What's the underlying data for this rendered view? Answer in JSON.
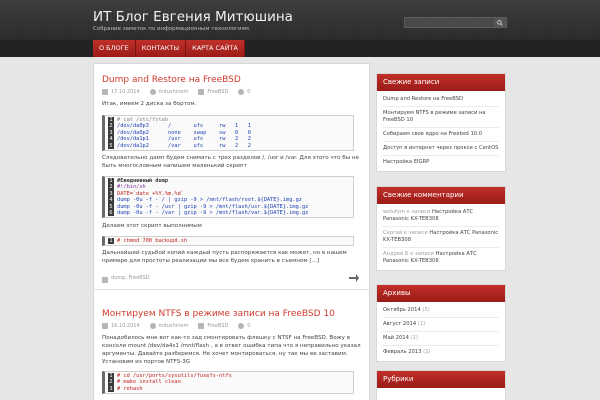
{
  "header": {
    "site_title": "ИТ Блог Евгения Митюшина",
    "site_description": "Собрание заметок по информационным технологиям",
    "search_placeholder": ""
  },
  "nav": {
    "items": [
      {
        "label": "О БЛОГЕ"
      },
      {
        "label": "КОНТАКТЫ"
      },
      {
        "label": "КАРТА САЙТА"
      }
    ]
  },
  "posts": [
    {
      "title": "Dump and Restore на FreeBSD",
      "date": "17.10.2014",
      "author": "mitushinem",
      "category": "FreeBSD",
      "comments": "0",
      "intro": "Итак, имеем 2 диска за бортом.",
      "code1": [
        "# cat /etc/fstab",
        "/dev/da0p3      /       ufs     rw   1   1",
        "/dev/da0p2      none    swap    sw   0   0",
        "/dev/da1p1      /usr    ufs     rw   2   2",
        "/dev/da1p2      /var    ufs     rw   2   2"
      ],
      "para2": "Следовательно дамп будем снимать с трех разделов /, /usr и /var. Для этого что бы не быть многословным напишем маленький скрипт",
      "code2": [
        "#Ежедневный dump",
        "#!/bin/sh",
        "DATE=`date +%Y.%m.%d`",
        "dump -0u -f - / | gzip -9 > /mnt/flash/root.${DATE}.img.gz",
        "dump -0u -f - /usr | gzip -9 > /mnt/flash/usr.${DATE}.img.gz",
        "dump -0u -f - /var | gzip -9 > /mnt/flash/var.${DATE}.img.gz"
      ],
      "para3": "Делаем этот скрипт выполнимым",
      "code3": [
        "# chmod 700 backupd.sh"
      ],
      "para4": "Дальнейшей судьбой копий каждый пусть распоряжается как может, но в нашем примере для простоты реализации мы все будем хранить в съемном [...]",
      "tags": "dump, FreeBSD"
    },
    {
      "title": "Монтируем NTFS в режиме записи на FreeBSD 10",
      "date": "16.10.2014",
      "author": "mitushinem",
      "category": "FreeBSD",
      "comments": "0",
      "intro": "Понадобилось мне вот как-то зад смонтировать флешку с NTSF на FreeBSD. Вожу в консоли mount /dev/da4s1 /mnt/flash , а в ответ ошибка типа что я неправильно указал аргументы. Давайте разберемся. Не хочет монтироваться, ну так мы ее заставим. Установим из портов NTFS-3G",
      "code1": [
        "# cd /usr/ports/sysutils/fusefs-ntfs",
        "# make install clean",
        "# rehash"
      ]
    }
  ],
  "sidebar": {
    "recent_posts": {
      "title": "Свежие записи",
      "items": [
        "Dump and Restore на FreeBSD",
        "Монтируем NTFS в режиме записи на FreeBSD 10",
        "Собираем свое ядро на Freebsd 10.0",
        "Доступ в интернет через прокси с CentOS",
        "Настройка EIGRP"
      ]
    },
    "recent_comments": {
      "title": "Свежие комментарии",
      "items": [
        {
          "who": "wolufym к записи",
          "link": "Настройка АТС Panasonic KX-TEB308"
        },
        {
          "who": "Сергей к записи",
          "link": "Настройка АТС Panasonic KX-TEB308"
        },
        {
          "who": "Андрей Б к записи",
          "link": "Настройка АТС Panasonic KX-TEB308"
        }
      ]
    },
    "archives": {
      "title": "Архивы",
      "items": [
        {
          "label": "Октябрь 2014",
          "count": "(5)"
        },
        {
          "label": "Август 2014",
          "count": "(1)"
        },
        {
          "label": "Май 2014",
          "count": "(1)"
        },
        {
          "label": "Февраль 2013",
          "count": "(2)"
        }
      ]
    },
    "categories": {
      "title": "Рубрики"
    }
  }
}
